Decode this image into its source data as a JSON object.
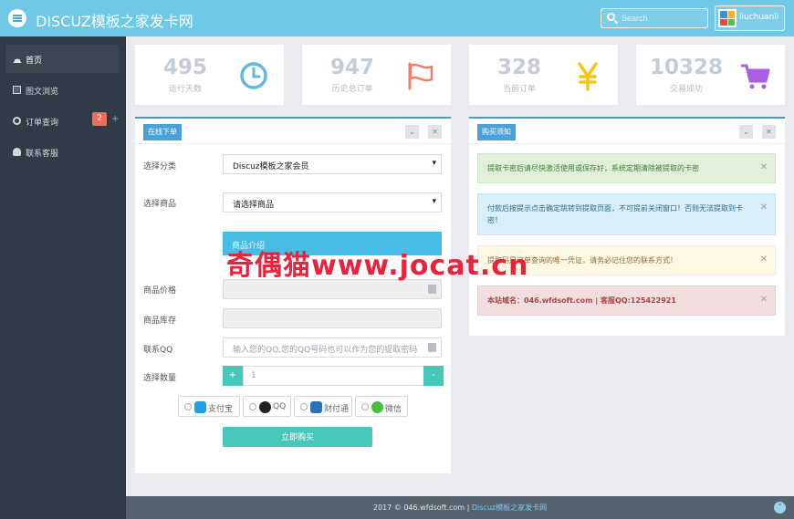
{
  "header": {
    "site_title": "DISCUZ模板之家发卡网",
    "search_placeholder": "Search",
    "username": "liuchuanli"
  },
  "sidebar": {
    "items": [
      {
        "label": "首页",
        "icon": "home-icon"
      },
      {
        "label": "图文浏览",
        "icon": "picture-icon"
      },
      {
        "label": "订单查询",
        "icon": "search-icon",
        "badge": "2",
        "extra": "+"
      },
      {
        "label": "联系客服",
        "icon": "user-icon"
      }
    ]
  },
  "stats": [
    {
      "value": "495",
      "caption": "运行天数",
      "icon": "clock-icon",
      "color": "#5fb8e0"
    },
    {
      "value": "947",
      "caption": "历史总订单",
      "icon": "flag-icon",
      "color": "#f07d6b"
    },
    {
      "value": "328",
      "caption": "当前订单",
      "icon": "yen-icon",
      "color": "#f5c518"
    },
    {
      "value": "10328",
      "caption": "交易成功",
      "icon": "cart-icon",
      "color": "#a95fe0"
    }
  ],
  "order_panel": {
    "tag": "在线下单",
    "category_label": "选择分类",
    "category_value": "Discuz模板之家会员",
    "product_label": "选择商品",
    "product_value": "请选择商品",
    "info_text": "商品介绍",
    "price_label": "商品价格",
    "stock_label": "商品库存",
    "qq_label": "联系QQ",
    "qq_placeholder": "输入您的QQ,您的QQ号码也可以作为您的提取密码",
    "qty_label": "选择数量",
    "qty_value": "1",
    "qty_plus": "+",
    "qty_minus": "-",
    "payments": [
      "支付宝",
      "QQ",
      "财付通",
      "微信"
    ],
    "buy_label": "立即购买"
  },
  "notice_panel": {
    "tag": "购买须知",
    "alerts": [
      "提取卡密后请尽快激活使用或保存好，系统定期清除被提取的卡密",
      "付款后按提示点击确定跳转到提取页面，不可提前关闭窗口！否则无法提取到卡密！",
      "提取码是订单查询的唯一凭证，请务必记住您的联系方式！",
      "本站域名：046.wfdsoft.com | 客服QQ:125422921"
    ]
  },
  "watermark": "奇偶猫www.jocat.cn",
  "footer": {
    "copyright": "2017 © 046.wfdsoft.com | ",
    "link": "Discuz模板之家发卡网"
  },
  "colors": {
    "topbar": "#6ec8e6",
    "sidebar": "#2f3b47",
    "accent": "#47c7b9",
    "panel_tag": "#4aa0d8"
  }
}
